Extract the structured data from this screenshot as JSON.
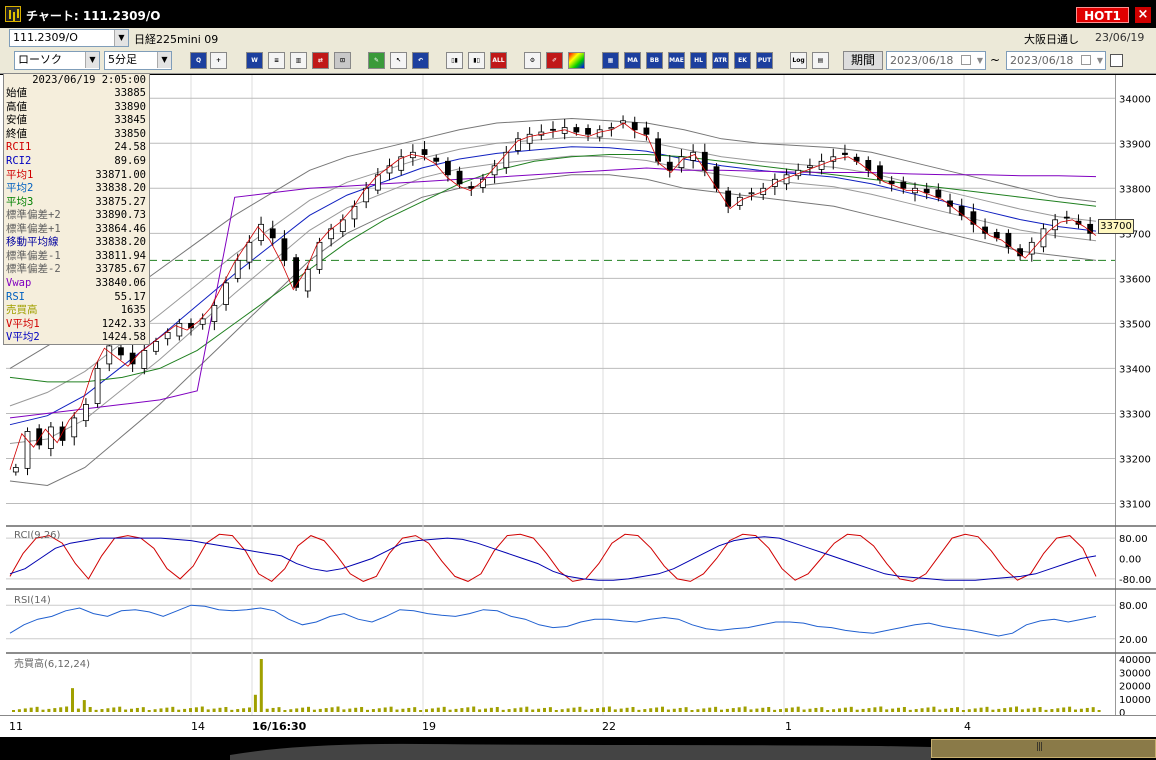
{
  "window": {
    "title": "チャート: 111.2309/O",
    "hot_label": "HOT1",
    "close_icon": "×"
  },
  "toolbar": {
    "symbol": "111.2309/O",
    "name": "日経225mini 09",
    "session": "大阪日通し",
    "date": "23/06/19",
    "chart_type": "ローソク",
    "interval": "5分足",
    "period_label": "期間",
    "date_from": "2023/06/18",
    "date_to": "2023/06/18",
    "tilde": "~",
    "buttons": [
      {
        "name": "zoom-button",
        "label": "Q",
        "style": "blue"
      },
      {
        "name": "cursor-button",
        "label": "+",
        "style": ""
      },
      {
        "name": "trend-button",
        "label": "W",
        "style": "blue"
      },
      {
        "name": "draw-button",
        "label": "≡",
        "style": ""
      },
      {
        "name": "bar-button",
        "label": "▥",
        "style": ""
      },
      {
        "name": "trade-button",
        "label": "⇄",
        "style": "red"
      },
      {
        "name": "lock-button",
        "label": "⊡",
        "style": "gray"
      },
      {
        "name": "pencil-button",
        "label": "✎",
        "style": "green"
      },
      {
        "name": "arrow-button",
        "label": "↖",
        "style": ""
      },
      {
        "name": "undo-button",
        "label": "↶",
        "style": "blue"
      },
      {
        "name": "candle-button",
        "label": "▯▮",
        "style": ""
      },
      {
        "name": "candle2-button",
        "label": "▮▯",
        "style": ""
      },
      {
        "name": "all-button",
        "label": "ALL",
        "style": "red"
      },
      {
        "name": "tool-button",
        "label": "⚙",
        "style": ""
      },
      {
        "name": "brush-button",
        "label": "✐",
        "style": "red"
      },
      {
        "name": "color-button",
        "label": "",
        "style": "rainbow"
      },
      {
        "name": "grid-button",
        "label": "▦",
        "style": "blue"
      },
      {
        "name": "ma-button",
        "label": "MA",
        "style": "blue"
      },
      {
        "name": "bb-button",
        "label": "BB",
        "style": "blue"
      },
      {
        "name": "mae-button",
        "label": "MAE",
        "style": "blue"
      },
      {
        "name": "hl-button",
        "label": "HL",
        "style": "blue"
      },
      {
        "name": "atr-button",
        "label": "ATR",
        "style": "blue"
      },
      {
        "name": "ichimoku-button",
        "label": "EK",
        "style": "blue"
      },
      {
        "name": "put-button",
        "label": "PUT",
        "style": "blue"
      },
      {
        "name": "log-button",
        "label": "Log",
        "style": ""
      },
      {
        "name": "export-button",
        "label": "▤",
        "style": ""
      }
    ]
  },
  "info": {
    "timestamp": "2023/06/19  2:05:00",
    "rows": [
      {
        "k": "始値",
        "v": "33885",
        "c": "#000000"
      },
      {
        "k": "高値",
        "v": "33890",
        "c": "#000000"
      },
      {
        "k": "安値",
        "v": "33845",
        "c": "#000000"
      },
      {
        "k": "終値",
        "v": "33850",
        "c": "#000000"
      },
      {
        "k": "RCI1",
        "v": "24.58",
        "c": "#d00000"
      },
      {
        "k": "RCI2",
        "v": "89.69",
        "c": "#0000c0"
      },
      {
        "k": "平均1",
        "v": "33871.00",
        "c": "#d00000"
      },
      {
        "k": "平均2",
        "v": "33838.20",
        "c": "#0060c0"
      },
      {
        "k": "平均3",
        "v": "33875.27",
        "c": "#008000"
      },
      {
        "k": "標準偏差+2",
        "v": "33890.73",
        "c": "#606060"
      },
      {
        "k": "標準偏差+1",
        "v": "33864.46",
        "c": "#606060"
      },
      {
        "k": "移動平均線",
        "v": "33838.20",
        "c": "#0000a0"
      },
      {
        "k": "標準偏差-1",
        "v": "33811.94",
        "c": "#606060"
      },
      {
        "k": "標準偏差-2",
        "v": "33785.67",
        "c": "#606060"
      },
      {
        "k": "Vwap",
        "v": "33840.06",
        "c": "#8000c0"
      },
      {
        "k": "RSI",
        "v": "55.17",
        "c": "#0060c0"
      },
      {
        "k": "売買高",
        "v": "1635",
        "c": "#a0a000"
      },
      {
        "k": "V平均1",
        "v": "1242.33",
        "c": "#d00000"
      },
      {
        "k": "V平均2",
        "v": "1424.58",
        "c": "#0000c0"
      }
    ]
  },
  "price_tag": "33700",
  "chart_data": [
    {
      "type": "candlestick",
      "yticks": [
        33100,
        33200,
        33300,
        33400,
        33500,
        33600,
        33700,
        33800,
        33900,
        34000
      ],
      "ylim": [
        33070,
        34025
      ],
      "ohlc_path": [
        33180,
        33260,
        33230,
        33270,
        33240,
        33290,
        33320,
        33400,
        33450,
        33430,
        33410,
        33440,
        33460,
        33480,
        33500,
        33490,
        33510,
        33540,
        33590,
        33640,
        33680,
        33720,
        33690,
        33640,
        33580,
        33620,
        33680,
        33710,
        33730,
        33760,
        33800,
        33830,
        33850,
        33870,
        33880,
        33875,
        33860,
        33830,
        33810,
        33800,
        33820,
        33850,
        33880,
        33910,
        33920,
        33925,
        33930,
        33935,
        33925,
        33920,
        33930,
        33935,
        33950,
        33930,
        33920,
        33860,
        33840,
        33870,
        33880,
        33840,
        33800,
        33760,
        33780,
        33790,
        33800,
        33820,
        33830,
        33840,
        33850,
        33860,
        33870,
        33875,
        33860,
        33840,
        33820,
        33810,
        33800,
        33800,
        33790,
        33780,
        33760,
        33740,
        33720,
        33700,
        33690,
        33670,
        33650,
        33680,
        33710,
        33730,
        33735,
        33720,
        33700
      ],
      "bb_upper2": [
        33400,
        33450,
        33500,
        33560,
        33620,
        33680,
        33740,
        33790,
        33840,
        33870,
        33890,
        33910,
        33930,
        33945,
        33950,
        33955,
        33950,
        33945,
        33930,
        33910,
        33900,
        33895,
        33890,
        33880,
        33860,
        33840,
        33820,
        33800,
        33780,
        33770
      ],
      "bb_lower2": [
        33150,
        33140,
        33180,
        33250,
        33320,
        33400,
        33480,
        33560,
        33640,
        33700,
        33740,
        33780,
        33800,
        33810,
        33820,
        33830,
        33830,
        33820,
        33800,
        33790,
        33780,
        33770,
        33760,
        33740,
        33720,
        33700,
        33680,
        33660,
        33650,
        33640
      ],
      "ma_long": [
        33380,
        33370,
        33370,
        33380,
        33400,
        33440,
        33500,
        33560,
        33620,
        33680,
        33730,
        33770,
        33810,
        33840,
        33860,
        33870,
        33875,
        33875,
        33870,
        33860,
        33850,
        33840,
        33830,
        33820,
        33810,
        33800,
        33790,
        33780,
        33770,
        33760
      ],
      "vwap": [
        33290,
        33300,
        33310,
        33320,
        33330,
        33350,
        33780,
        33790,
        33800,
        33805,
        33810,
        33815,
        33820,
        33825,
        33830,
        33835,
        33840,
        33845,
        33840,
        33840,
        33838,
        33836,
        33835,
        33835,
        33832,
        33830,
        33830,
        33828,
        33828,
        33826
      ],
      "dashed_level": 33640
    },
    {
      "type": "line",
      "title": "RCI(9,26)",
      "yticks_label": [
        "80.00",
        "0.00",
        "-80.00"
      ],
      "ylim": [
        -100,
        100
      ],
      "series": [
        {
          "values": [
            -70,
            20,
            80,
            90,
            60,
            -20,
            -80,
            10,
            80,
            90,
            80,
            40,
            -40,
            -80,
            -30,
            60,
            95,
            90,
            30,
            -60,
            -90,
            -40,
            50,
            90,
            70,
            10,
            -60,
            -90,
            -70,
            20,
            80,
            90,
            60,
            -10,
            -70,
            -90,
            -60,
            30,
            90,
            95,
            80,
            20,
            -50,
            -90,
            -80,
            -20,
            60,
            95,
            90,
            40,
            -30,
            -80,
            -90,
            -60,
            0,
            70,
            95,
            90,
            40,
            -40,
            -85,
            -60,
            0,
            60,
            95,
            90,
            50,
            -20,
            -80,
            -90,
            -60,
            10,
            80,
            95,
            85,
            30,
            -40,
            -85,
            -60,
            20,
            80,
            90,
            40,
            -70
          ]
        },
        {
          "values": [
            -60,
            -40,
            0,
            40,
            60,
            70,
            80,
            80,
            80,
            80,
            80,
            75,
            70,
            60,
            50,
            40,
            30,
            20,
            10,
            -20,
            -40,
            -50,
            -40,
            -20,
            0,
            30,
            60,
            70,
            75,
            80,
            75,
            60,
            40,
            20,
            0,
            -20,
            -50,
            -70,
            -80,
            -85,
            -85,
            -80,
            -70,
            -60,
            -40,
            -10,
            20,
            50,
            70,
            80,
            85,
            80,
            60,
            40,
            20,
            0,
            -20,
            -40,
            -60,
            -70,
            -75,
            -80,
            -85,
            -85,
            -85,
            -80,
            -75,
            -70,
            -60,
            -40,
            -20,
            0,
            10
          ]
        }
      ]
    },
    {
      "type": "line",
      "title": "RSI(14)",
      "yticks_label": [
        "80.00",
        "20.00"
      ],
      "ylim": [
        0,
        100
      ],
      "series": [
        {
          "values": [
            30,
            45,
            55,
            60,
            70,
            75,
            65,
            60,
            70,
            72,
            68,
            60,
            70,
            80,
            78,
            72,
            70,
            72,
            75,
            70,
            55,
            45,
            50,
            60,
            65,
            55,
            50,
            60,
            72,
            70,
            65,
            62,
            60,
            65,
            72,
            70,
            60,
            55,
            45,
            40,
            42,
            50,
            55,
            55,
            52,
            50,
            55,
            58,
            55,
            45,
            38,
            35,
            38,
            40,
            45,
            50,
            50,
            48,
            42,
            40,
            35,
            32,
            30,
            35,
            40,
            45,
            48,
            42,
            38,
            35,
            30,
            25,
            30,
            45,
            52,
            55,
            50,
            55,
            60
          ]
        }
      ]
    },
    {
      "type": "bar",
      "title": "売買高(6,12,24)",
      "yticks_label": [
        "40000",
        "30000",
        "20000",
        "10000",
        "0"
      ],
      "ylim": [
        0,
        40000
      ]
    }
  ],
  "date_axis": [
    {
      "label": "11",
      "bold": false
    },
    {
      "label": "14",
      "bold": false
    },
    {
      "label": "16/16:30",
      "bold": true
    },
    {
      "label": "19",
      "bold": false
    },
    {
      "label": "22",
      "bold": false
    },
    {
      "label": "1",
      "bold": false
    },
    {
      "label": "4",
      "bold": false
    }
  ]
}
